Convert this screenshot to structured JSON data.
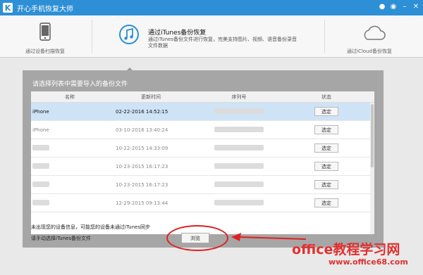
{
  "app": {
    "logo_letter": "K",
    "title": "开心手机恢复大师"
  },
  "window_icons": [
    "wechat-icon",
    "chat-icon",
    "minimize-icon",
    "close-icon"
  ],
  "modes": {
    "device": {
      "label": "通过设备扫描恢复"
    },
    "itunes": {
      "title": "通过iTunes备份恢复",
      "desc": "通过iTunes备份文件进行恢复，完美支持图片、视频、语音备份录音文件数据"
    },
    "icloud": {
      "label": "通过iCloud备份恢复"
    }
  },
  "panel": {
    "title": "请选择列表中需要导入的备份文件",
    "columns": [
      "名称",
      "更新时间",
      "序列号",
      "状态"
    ],
    "rows": [
      {
        "name": "iPhone",
        "time": "02-22-2016 14:52:15",
        "action": "选定",
        "selected": true
      },
      {
        "name": "iPhone",
        "time": "03-10-2016 13:40:24",
        "action": "选定",
        "selected": false
      },
      {
        "name": "",
        "time": "10-22-2015 14:33:09",
        "action": "选定",
        "selected": false
      },
      {
        "name": "",
        "time": "10-23-2015 16:17:23",
        "action": "选定",
        "selected": false
      },
      {
        "name": "",
        "time": "10-23-2015 16:17:23",
        "action": "选定",
        "selected": false
      },
      {
        "name": "",
        "time": "12-29-2015 09:13:44",
        "action": "选定",
        "selected": false
      }
    ]
  },
  "notice": {
    "line1": "未出现您的设备信息，可能您的设备未通过iTunes同步",
    "line2": "请手动选择iTunes备份文件",
    "browse": "浏览"
  },
  "watermark": {
    "main": "office教程学习网",
    "url": "www.office68.com"
  },
  "colors": {
    "titlebar": "#2d8fd6",
    "accent": "#e02020",
    "selected_row": "#cfe3f7"
  }
}
